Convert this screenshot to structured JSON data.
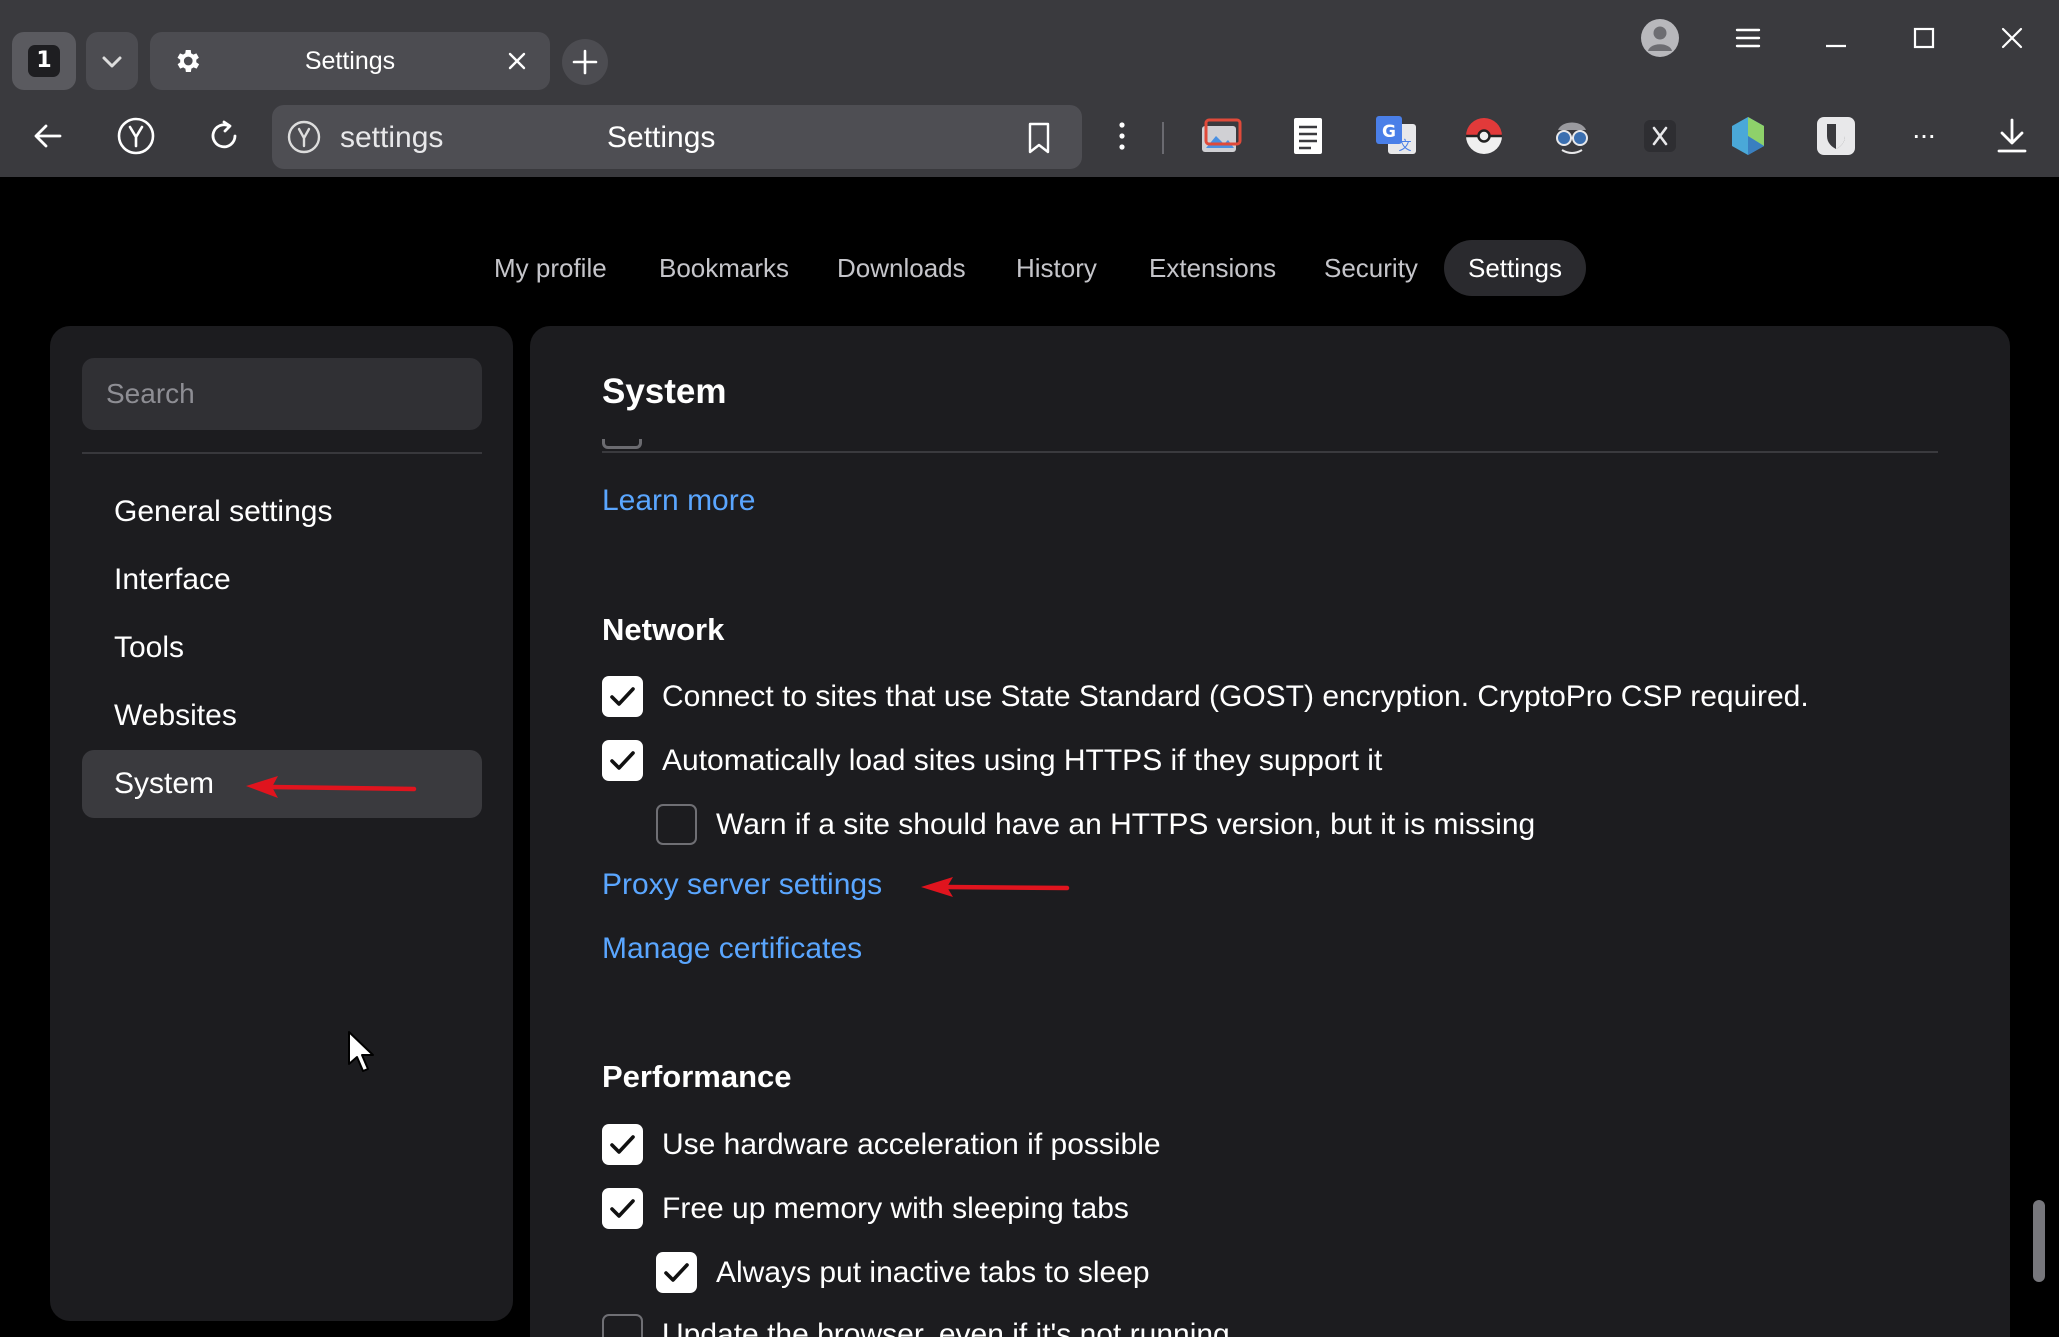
{
  "tabs": {
    "count": "1",
    "active_title": "Settings"
  },
  "address": {
    "url": "settings",
    "page_title": "Settings"
  },
  "extensions": {
    "more_label": "..."
  },
  "top_nav": [
    "My profile",
    "Bookmarks",
    "Downloads",
    "History",
    "Extensions",
    "Security",
    "Settings"
  ],
  "top_nav_active": "Settings",
  "sidebar": {
    "search_placeholder": "Search",
    "items": [
      "General settings",
      "Interface",
      "Tools",
      "Websites",
      "System"
    ],
    "active": "System"
  },
  "main": {
    "title": "System",
    "learn_more": "Learn more",
    "network": {
      "heading": "Network",
      "options": [
        {
          "label": "Connect to sites that use State Standard (GOST) encryption. CryptoPro CSP required.",
          "checked": true
        },
        {
          "label": "Automatically load sites using HTTPS if they support it",
          "checked": true
        },
        {
          "label": "Warn if a site should have an HTTPS version, but it is missing",
          "checked": false
        }
      ],
      "proxy_link": "Proxy server settings",
      "certs_link": "Manage certificates"
    },
    "performance": {
      "heading": "Performance",
      "options": [
        {
          "label": "Use hardware acceleration if possible",
          "checked": true
        },
        {
          "label": "Free up memory with sleeping tabs",
          "checked": true
        },
        {
          "label": "Always put inactive tabs to sleep",
          "checked": true
        },
        {
          "label": "Update the browser, even if it's not running",
          "checked": false
        }
      ]
    }
  },
  "colors": {
    "link": "#5aa6ff",
    "annotation_arrow": "#e0141e",
    "chrome_bg": "#3a3a3e",
    "panel_bg": "#1c1c1f"
  }
}
